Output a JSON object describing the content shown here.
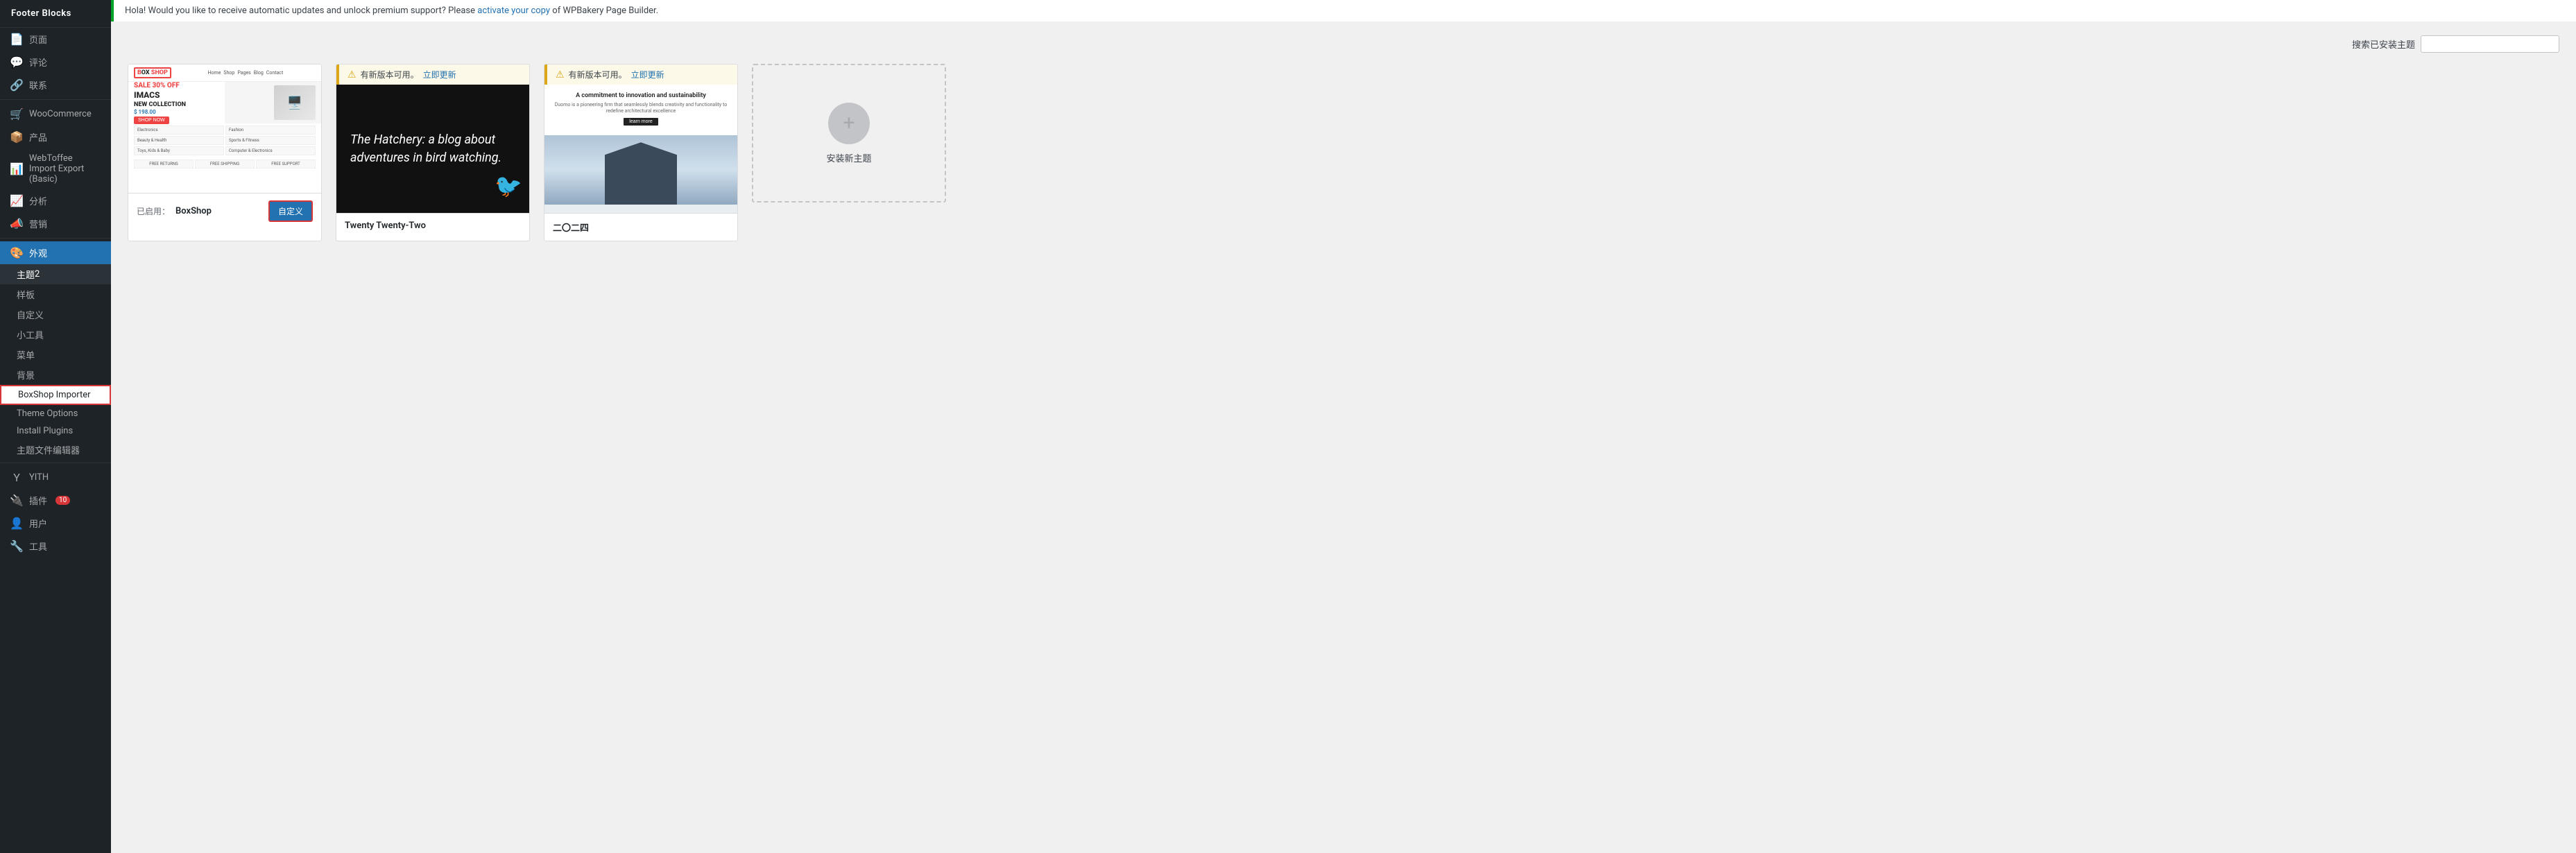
{
  "sidebar": {
    "logo": "Footer Blocks",
    "items": [
      {
        "id": "pages",
        "label": "页面",
        "icon": "📄",
        "indent": false
      },
      {
        "id": "comments",
        "label": "评论",
        "icon": "💬",
        "indent": false
      },
      {
        "id": "links",
        "label": "联系",
        "icon": "🔗",
        "indent": false
      },
      {
        "id": "woocommerce",
        "label": "WooCommerce",
        "icon": "🛒",
        "indent": false
      },
      {
        "id": "products",
        "label": "产品",
        "icon": "📦",
        "indent": false
      },
      {
        "id": "webtoffee",
        "label": "WebToffee Import Export (Basic)",
        "icon": "📊",
        "indent": false
      },
      {
        "id": "analytics",
        "label": "分析",
        "icon": "📈",
        "indent": false
      },
      {
        "id": "marketing",
        "label": "营销",
        "icon": "📣",
        "indent": false
      },
      {
        "id": "appearance",
        "label": "外观",
        "icon": "🎨",
        "indent": false,
        "active": true
      },
      {
        "id": "themes",
        "label": "主题",
        "badge": "2",
        "indent": true
      },
      {
        "id": "customize",
        "label": "样板",
        "indent": true
      },
      {
        "id": "custom2",
        "label": "自定义",
        "indent": true
      },
      {
        "id": "widgets",
        "label": "小工具",
        "indent": true
      },
      {
        "id": "menus",
        "label": "菜单",
        "indent": true
      },
      {
        "id": "background",
        "label": "背景",
        "indent": true
      },
      {
        "id": "boxshop-importer",
        "label": "BoxShop Importer",
        "indent": true,
        "highlighted": true
      },
      {
        "id": "theme-options",
        "label": "Theme Options",
        "indent": true
      },
      {
        "id": "install-plugins",
        "label": "Install Plugins",
        "indent": true
      },
      {
        "id": "theme-editor",
        "label": "主题文件编辑器",
        "indent": true
      },
      {
        "id": "yith",
        "label": "YITH",
        "icon": "Y",
        "indent": false
      },
      {
        "id": "plugins",
        "label": "插件",
        "icon": "🔌",
        "indent": false,
        "badge": "10"
      },
      {
        "id": "users",
        "label": "用户",
        "icon": "👤",
        "indent": false
      },
      {
        "id": "tools",
        "label": "工具",
        "icon": "🔧",
        "indent": false
      }
    ]
  },
  "notice": {
    "text": "Hola! Would you like to receive automatic updates and unlock premium support? Please ",
    "link_text": "activate your copy",
    "text2": " of WPBakery Page Builder."
  },
  "themes_header": {
    "search_label": "搜索已安装主题",
    "search_placeholder": ""
  },
  "themes": [
    {
      "id": "boxshop",
      "active": true,
      "active_label": "已启用：",
      "name": "BoxShop",
      "customize_label": "自定义"
    },
    {
      "id": "twentytwentytwo",
      "active": false,
      "has_update": true,
      "update_text": "有新版本可用。",
      "update_link": "立即更新",
      "name": "Twenty Twenty-Two",
      "blog_title_italic": "The Hatchery:",
      "blog_subtitle": " a blog about adventures in bird watching."
    },
    {
      "id": "twentytwentyfour",
      "active": false,
      "has_update": true,
      "update_text": "有新版本可用。",
      "update_link": "立即更新",
      "name": "二〇二四",
      "building_title": "A commitment to innovation and sustainability",
      "building_subtitle": "Duomo is a pioneering firm that seamlessly blends creativity and functionality to redefine architectural excellence"
    }
  ],
  "install_theme": {
    "label": "安装新主题"
  }
}
